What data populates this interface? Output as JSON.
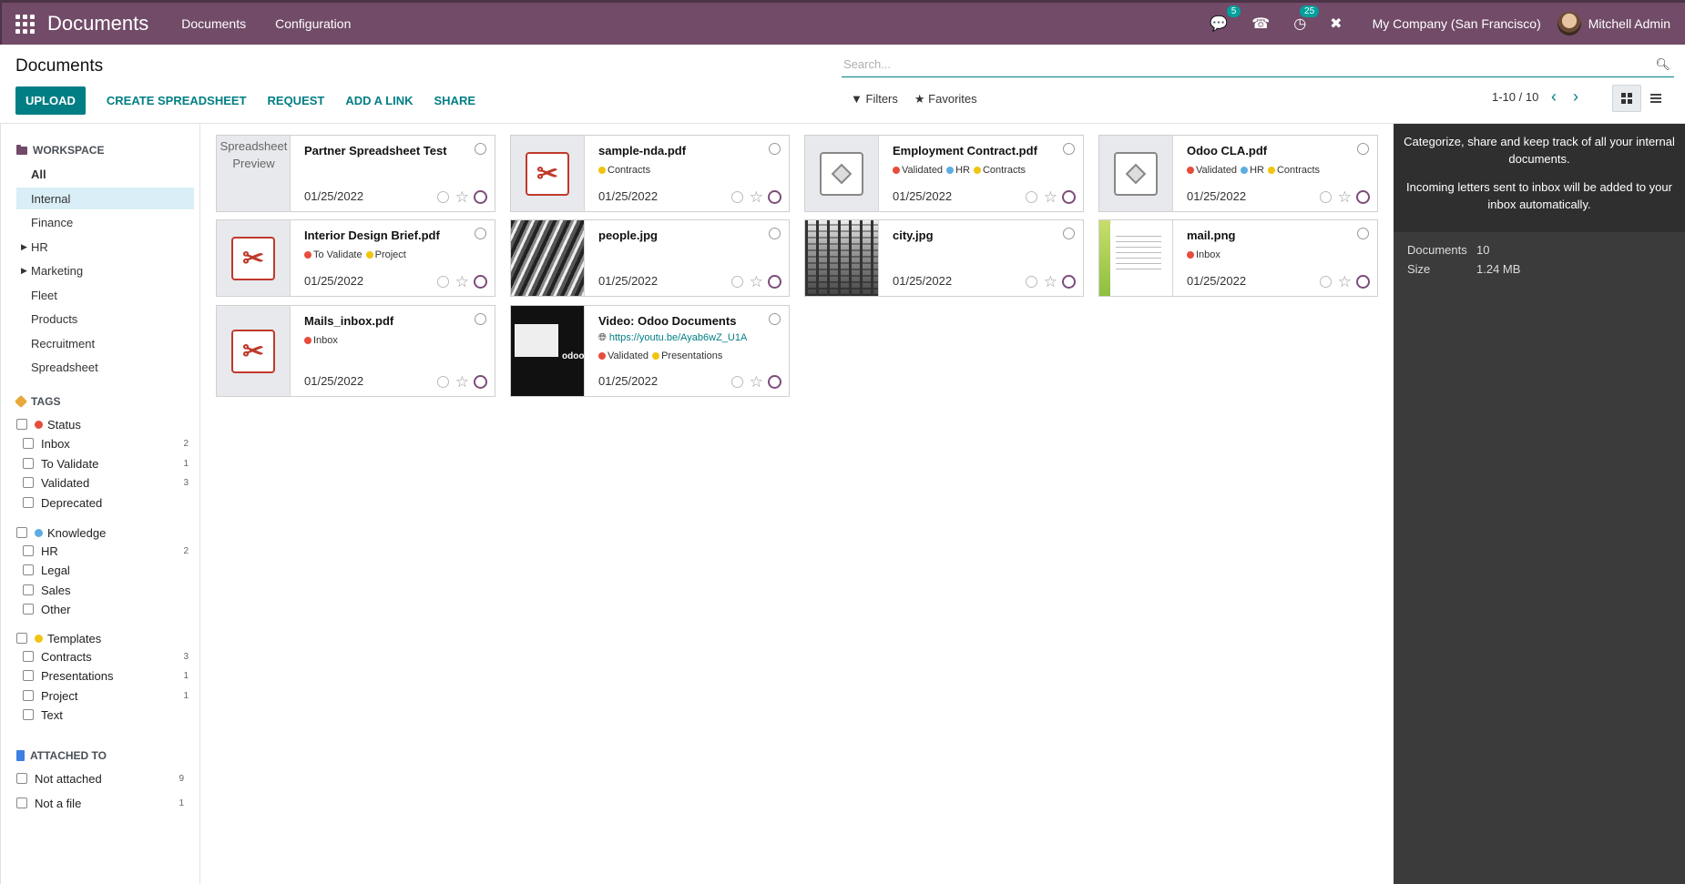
{
  "navbar": {
    "brand": "Documents",
    "menus": [
      "Documents",
      "Configuration"
    ],
    "messages_count": "5",
    "activities_count": "25",
    "company": "My Company (San Francisco)",
    "user": "Mitchell Admin"
  },
  "control_panel": {
    "title": "Documents",
    "search_placeholder": "Search...",
    "buttons": {
      "upload": "UPLOAD",
      "create_spreadsheet": "CREATE SPREADSHEET",
      "request": "REQUEST",
      "add_link": "ADD A LINK",
      "share": "SHARE"
    },
    "filters": "Filters",
    "favorites": "Favorites",
    "pager": "1-10 / 10"
  },
  "sidebar": {
    "workspace_title": "WORKSPACE",
    "workspaces": [
      "All",
      "Internal",
      "Finance",
      "HR",
      "Marketing",
      "Fleet",
      "Products",
      "Recruitment",
      "Spreadsheet"
    ],
    "tags_title": "TAGS",
    "tag_groups": [
      {
        "name": "Status",
        "color": "#e74c3c",
        "items": [
          {
            "name": "Inbox",
            "count": "2"
          },
          {
            "name": "To Validate",
            "count": "1"
          },
          {
            "name": "Validated",
            "count": "3"
          },
          {
            "name": "Deprecated",
            "count": ""
          }
        ]
      },
      {
        "name": "Knowledge",
        "color": "#5dade2",
        "items": [
          {
            "name": "HR",
            "count": "2"
          },
          {
            "name": "Legal",
            "count": ""
          },
          {
            "name": "Sales",
            "count": ""
          },
          {
            "name": "Other",
            "count": ""
          }
        ]
      },
      {
        "name": "Templates",
        "color": "#f1c40f",
        "items": [
          {
            "name": "Contracts",
            "count": "3"
          },
          {
            "name": "Presentations",
            "count": "1"
          },
          {
            "name": "Project",
            "count": "1"
          },
          {
            "name": "Text",
            "count": ""
          }
        ]
      }
    ],
    "attached_title": "ATTACHED TO",
    "attached": [
      {
        "name": "Not attached",
        "count": "9"
      },
      {
        "name": "Not a file",
        "count": "1"
      }
    ]
  },
  "cards": [
    {
      "name": "Partner Spreadsheet Test",
      "date": "01/25/2022",
      "thumb": "spreadsheet",
      "thumb_text": "Spreadsheet Preview"
    },
    {
      "name": "sample-nda.pdf",
      "date": "01/25/2022",
      "thumb": "pdf",
      "tags": [
        "Contracts"
      ]
    },
    {
      "name": "Employment Contract.pdf",
      "date": "01/25/2022",
      "thumb": "binary",
      "tags": [
        "Validated",
        "HR",
        "Contracts"
      ]
    },
    {
      "name": "Odoo CLA.pdf",
      "date": "01/25/2022",
      "thumb": "binary",
      "tags": [
        "Validated",
        "HR",
        "Contracts"
      ]
    },
    {
      "name": "Interior Design Brief.pdf",
      "date": "01/25/2022",
      "thumb": "pdf",
      "tags": [
        "To Validate",
        "Project"
      ]
    },
    {
      "name": "people.jpg",
      "date": "01/25/2022",
      "thumb": "people"
    },
    {
      "name": "city.jpg",
      "date": "01/25/2022",
      "thumb": "city"
    },
    {
      "name": "mail.png",
      "date": "01/25/2022",
      "thumb": "mail",
      "tags": [
        "Inbox"
      ]
    },
    {
      "name": "Mails_inbox.pdf",
      "date": "01/25/2022",
      "thumb": "pdf",
      "tags": [
        "Inbox"
      ]
    },
    {
      "name": "Video: Odoo Documents",
      "date": "01/25/2022",
      "thumb": "video",
      "url": "https://youtu.be/Ayab6wZ_U1A",
      "tags": [
        "Validated",
        "Presentations"
      ]
    }
  ],
  "tag_colors": {
    "Contracts": "#f1c40f",
    "Validated": "#e74c3c",
    "HR": "#5dade2",
    "To Validate": "#e74c3c",
    "Project": "#f1c40f",
    "Inbox": "#e74c3c",
    "Presentations": "#f1c40f"
  },
  "inspector": {
    "help_line1": "Categorize, share and keep track of all your internal documents.",
    "help_line2": "Incoming letters sent to inbox will be added to your inbox automatically.",
    "documents_label": "Documents",
    "documents_value": "10",
    "size_label": "Size",
    "size_value": "1.24 MB"
  }
}
